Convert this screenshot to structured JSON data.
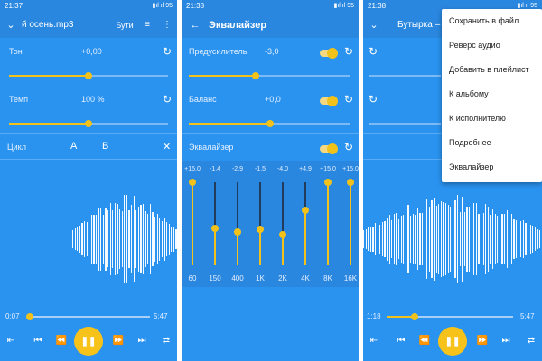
{
  "colors": {
    "accent": "#f2c21a",
    "panel": "#2a93f0",
    "appbar": "#2a87e0"
  },
  "panel1": {
    "status": {
      "time": "21:37",
      "right": "▮ıl ıl 95"
    },
    "title": "й осень.mp3",
    "title_right": "Бути",
    "icons": [
      "chevron-down-icon",
      "playlist-icon",
      "more-icon"
    ],
    "rows": [
      {
        "label": "Тон",
        "value": "+0,00",
        "level": 0.5
      },
      {
        "label": "Темп",
        "value": "100 %",
        "level": 0.5
      }
    ],
    "loop": {
      "label": "Цикл",
      "a": "A",
      "b": "B",
      "close": "✕"
    },
    "time_start": "0:07",
    "time_end": "5:47",
    "progress": 0.02
  },
  "panel2": {
    "status": {
      "time": "21:38",
      "right": "▮ıl ıl 95"
    },
    "title": "Эквалайзер",
    "rows": [
      {
        "label": "Предусилитель",
        "value": "-3,0",
        "level": 0.47
      },
      {
        "label": "Баланс",
        "value": "+0,0",
        "level": 0.5
      }
    ],
    "eq_label": "Эквалайзер",
    "bands": [
      {
        "freq": "60",
        "gain": "+15,0",
        "level": 1.0
      },
      {
        "freq": "150",
        "gain": "-1,4",
        "level": 0.45
      },
      {
        "freq": "400",
        "gain": "-2,9",
        "level": 0.4
      },
      {
        "freq": "1K",
        "gain": "-1,5",
        "level": 0.44
      },
      {
        "freq": "2K",
        "gain": "-4,0",
        "level": 0.37
      },
      {
        "freq": "4K",
        "gain": "+4,9",
        "level": 0.66
      },
      {
        "freq": "8K",
        "gain": "+15,0",
        "level": 1.0
      },
      {
        "freq": "16K",
        "gain": "+15,0",
        "level": 1.0
      }
    ]
  },
  "panel3": {
    "status": {
      "time": "21:38",
      "right": "▮ıl ıl 95"
    },
    "title": "Бутырка – Н",
    "time_start": "1:18",
    "time_end": "5:47",
    "progress": 0.22
  },
  "menu": {
    "items": [
      "Сохранить в файл",
      "Реверс аудио",
      "Добавить в плейлист",
      "К альбому",
      "К исполнителю",
      "Подробнее",
      "Эквалайзер"
    ]
  },
  "controls": {
    "play_symbol": "❚❚",
    "prev": "⏮",
    "rew": "⏪",
    "ffw": "⏩",
    "next": "⏭",
    "left": "⇤",
    "right": "⇄"
  }
}
